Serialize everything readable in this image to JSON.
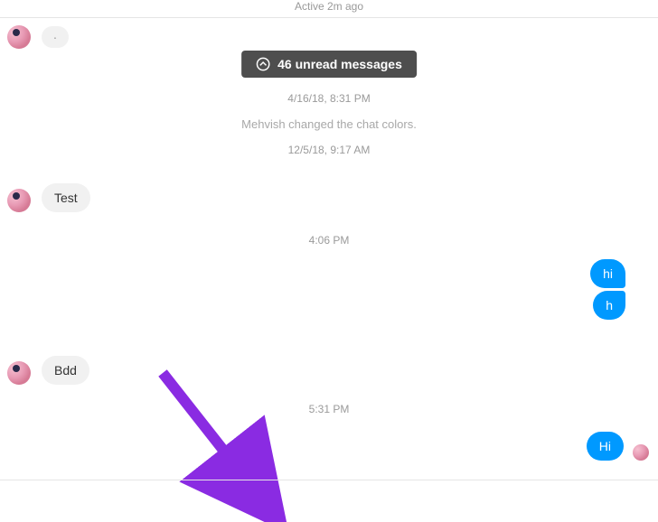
{
  "header": {
    "status": "Active 2m ago"
  },
  "unread": {
    "label": "46 unread messages"
  },
  "timestamps": {
    "ts1": "4/16/18, 8:31 PM",
    "ts2": "12/5/18, 9:17 AM",
    "ts3": "4:06 PM",
    "ts4": "5:31 PM"
  },
  "system": {
    "msg1": "Mehvish changed the chat colors."
  },
  "messages": {
    "m1": "Test",
    "m2": "hi",
    "m3": "h",
    "m4": "Bdd",
    "m5": "Hi"
  },
  "dot": "·",
  "colors": {
    "accent": "#0099ff",
    "arrow": "#8a2be2"
  }
}
